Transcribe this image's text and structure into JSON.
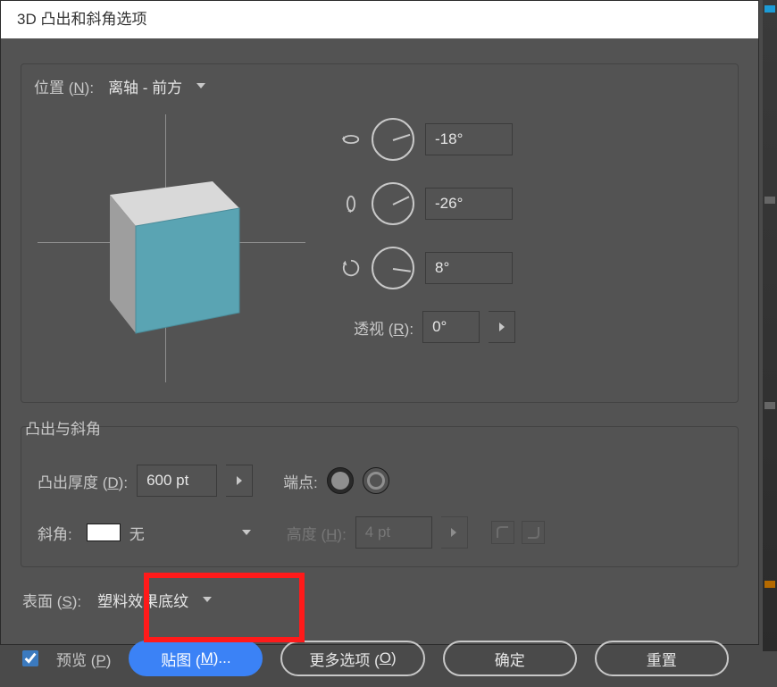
{
  "title": "3D 凸出和斜角选项",
  "position": {
    "label_prefix": "位置 (",
    "hotkey": "N",
    "label_suffix": "):",
    "value": "离轴 - 前方"
  },
  "angles": {
    "x": {
      "value": "-18°",
      "hand_deg": -18
    },
    "y": {
      "value": "-26°",
      "hand_deg": -26
    },
    "z": {
      "value": "8°",
      "hand_deg": 8
    }
  },
  "perspective": {
    "label_prefix": "透视 (",
    "hotkey": "R",
    "label_suffix": "):",
    "value": "0°"
  },
  "extrude_bevel": {
    "title": "凸出与斜角",
    "depth_label_prefix": "凸出厚度 (",
    "depth_hotkey": "D",
    "depth_label_suffix": "):",
    "depth_value": "600 pt",
    "cap_label": "端点:",
    "bevel_label": "斜角:",
    "bevel_value": "无",
    "height_label_prefix": "高度 (",
    "height_hotkey": "H",
    "height_label_suffix": "):",
    "height_value": "4 pt"
  },
  "surface": {
    "label_prefix": "表面 (",
    "hotkey": "S",
    "label_suffix": "):",
    "value": "塑料效果底纹"
  },
  "footer": {
    "preview_prefix": "预览 (",
    "preview_hotkey": "P",
    "preview_suffix": ")",
    "map_prefix": "贴图 (",
    "map_hotkey": "M",
    "map_suffix": ")...",
    "more_prefix": "更多选项 (",
    "more_hotkey": "O",
    "more_suffix": ")",
    "ok": "确定",
    "reset": "重置"
  },
  "colors": {
    "accent": "#3b82f6",
    "highlight": "#ff1a1a",
    "cube_front": "#5aa4b3"
  }
}
